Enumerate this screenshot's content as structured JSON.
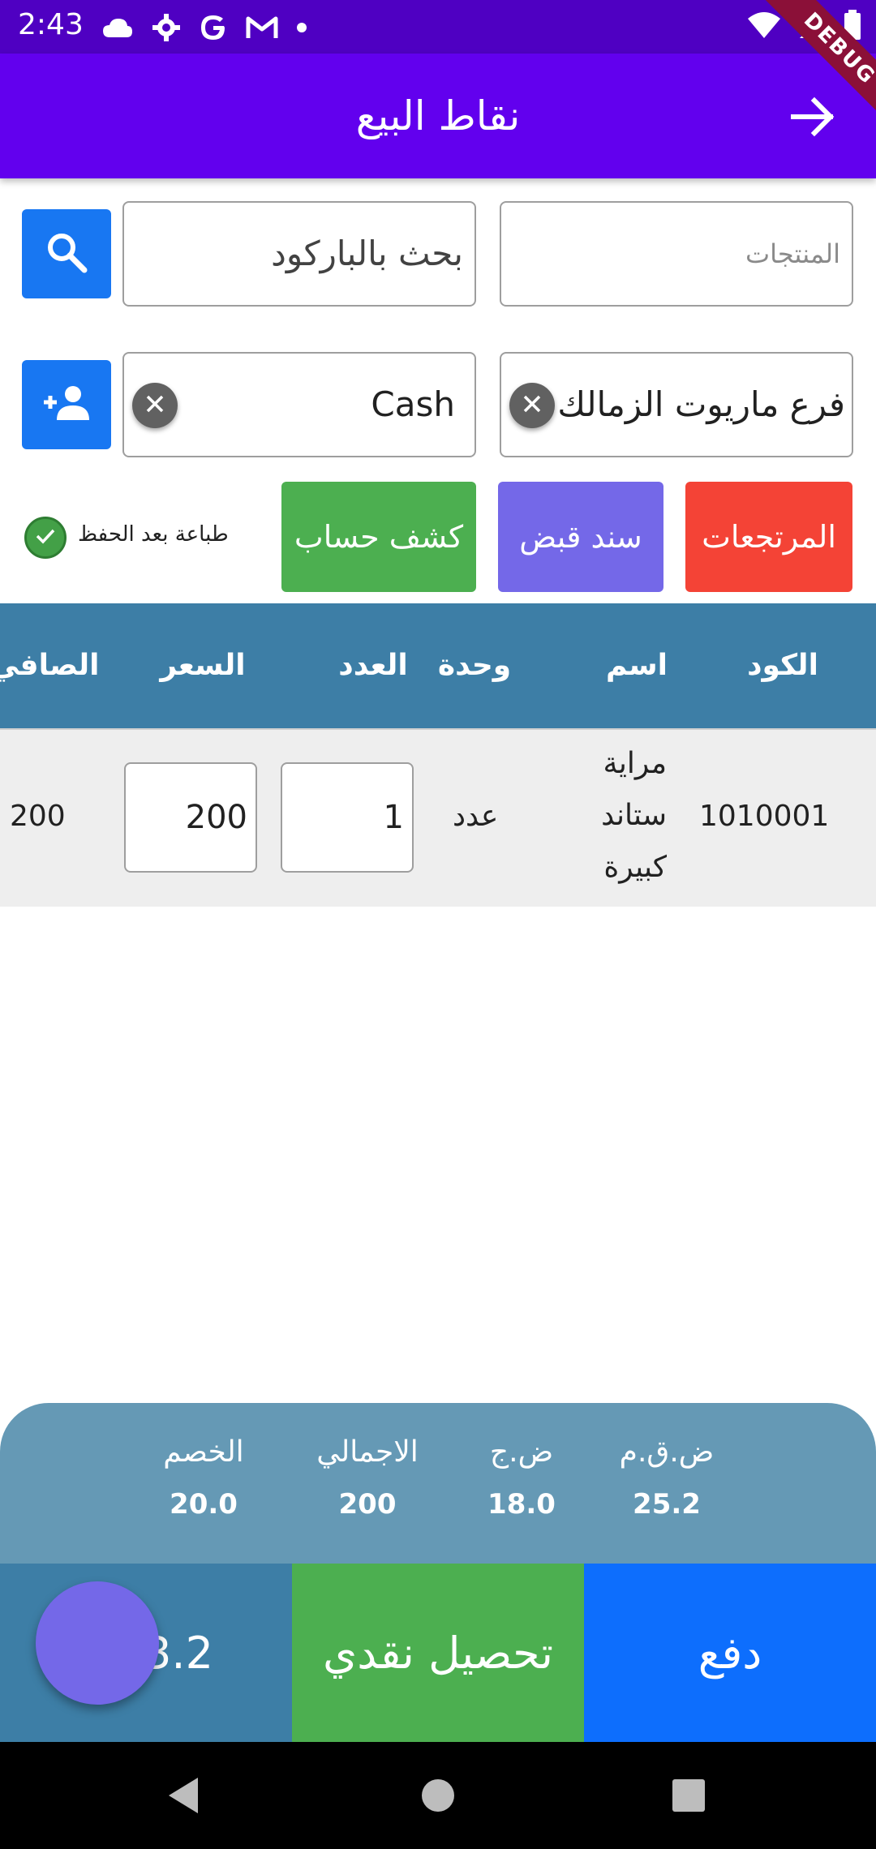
{
  "status_bar": {
    "time": "2:43",
    "debug_label": "DEBUG"
  },
  "app_bar": {
    "title": "نقاط البيع"
  },
  "search": {
    "products_placeholder": "المنتجات",
    "barcode_value": "بحث بالباركود"
  },
  "selectors": {
    "branch": "فرع ماريوت الزمالك",
    "customer": "Cash"
  },
  "actions": {
    "returns": "المرتجعات",
    "receipt": "سند قبض",
    "statement": "كشف حساب",
    "print_after_save": "طباعة بعد الحفظ",
    "print_after_save_checked": true
  },
  "colors": {
    "status_bar": "#4f00c2",
    "app_bar": "#6200ee",
    "returns_button": "#f44336",
    "receipt_button": "#7468e8",
    "statement_button": "#4caf50",
    "table_header": "#3d7ea6",
    "summary_panel": "#6599b5",
    "pay_button": "#0d6efd",
    "cash_button": "#4caf50"
  },
  "table": {
    "headers": {
      "code": "الكود",
      "name": "اسم",
      "unit": "وحدة",
      "qty": "العدد",
      "price": "السعر",
      "net": "الصافي"
    },
    "rows": [
      {
        "code": "1010001",
        "name_lines": [
          "مراية",
          "ستاند",
          "كبيرة"
        ],
        "unit": "عدد",
        "qty": "1",
        "price": "200",
        "net": "200"
      }
    ]
  },
  "summary": {
    "items": [
      {
        "label": "ض.ق.م",
        "value": "25.2"
      },
      {
        "label": "ض.ج",
        "value": "18.0"
      },
      {
        "label": "الاجمالي",
        "value": "200"
      },
      {
        "label": "الخصم",
        "value": "20.0"
      }
    ]
  },
  "bottom": {
    "pay": "دفع",
    "cash_collect": "تحصيل نقدي",
    "total_partial": "3.2"
  }
}
